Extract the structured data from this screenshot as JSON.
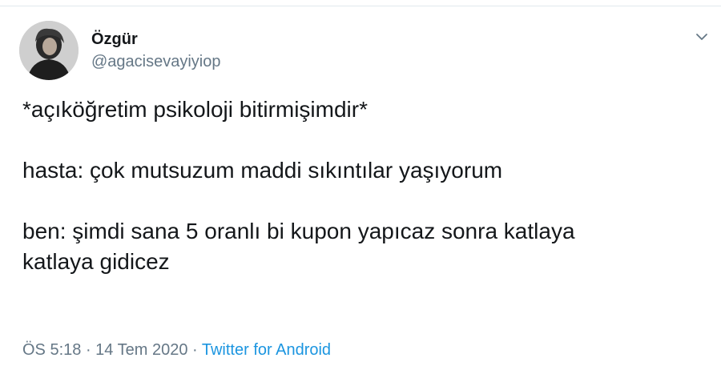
{
  "colors": {
    "text_primary": "#14171a",
    "text_secondary": "#657786",
    "link": "#1b95e0",
    "divider": "#e1e8ed"
  },
  "tweet": {
    "author": {
      "display_name": "Özgür",
      "handle": "@agacisevayiyiop",
      "avatar_icon": "avatar-photo"
    },
    "menu_icon": "chevron-down-icon",
    "lines": [
      "*açıköğretim psikoloji bitirmişimdir*",
      "",
      "hasta: çok mutsuzum maddi sıkıntılar yaşıyorum",
      "",
      "ben: şimdi sana 5 oranlı bi kupon yapıcaz sonra katlaya",
      "katlaya gidicez"
    ],
    "meta": {
      "time": "ÖS 5:18",
      "separator_1": " · ",
      "date": "14 Tem 2020",
      "separator_2": " · ",
      "source": "Twitter for Android"
    }
  }
}
